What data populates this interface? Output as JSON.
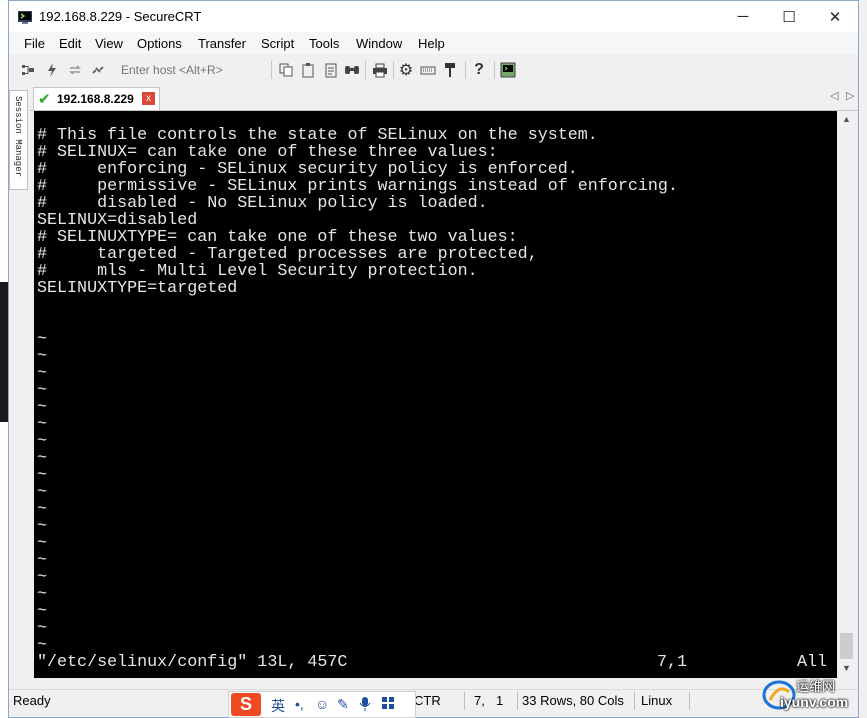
{
  "window": {
    "title": "192.168.8.229 - SecureCRT",
    "controls": {
      "minimize": "─",
      "maximize": "☐",
      "close": "✕"
    }
  },
  "menubar": {
    "items": [
      "File",
      "Edit",
      "View",
      "Options",
      "Transfer",
      "Script",
      "Tools",
      "Window",
      "Help"
    ]
  },
  "toolbar": {
    "host_placeholder": "Enter host <Alt+R>",
    "icons": [
      "connect-icon",
      "quick-connect-icon",
      "reconnect-icon",
      "disconnect-icon",
      "copy-icon",
      "paste-icon",
      "clipboard-icon",
      "find-icon",
      "print-icon",
      "settings-icon",
      "keymap-icon",
      "sftp-icon",
      "help-icon",
      "about-icon"
    ]
  },
  "sidebar": {
    "session_manager_label": "Session Manager"
  },
  "tabs": [
    {
      "label": "192.168.8.229",
      "status": "connected",
      "close": "x"
    }
  ],
  "tab_nav": {
    "prev": "◁",
    "next": "▷"
  },
  "terminal": {
    "lines": [
      "# This file controls the state of SELinux on the system.",
      "# SELINUX= can take one of these three values:",
      "#     enforcing - SELinux security policy is enforced.",
      "#     permissive - SELinux prints warnings instead of enforcing.",
      "#     disabled - No SELinux policy is loaded.",
      "SELINUX=disabled",
      "# SELINUXTYPE= can take one of these two values:",
      "#     targeted - Targeted processes are protected,",
      "#     mls - Multi Level Security protection.",
      "SELINUXTYPE=targeted",
      "",
      "",
      "~",
      "~",
      "~",
      "~",
      "~",
      "~",
      "~",
      "~",
      "~",
      "~",
      "~",
      "~",
      "~",
      "~",
      "~",
      "~",
      "~",
      "~",
      "~"
    ],
    "status_file": "\"/etc/selinux/config\" 13L, 457C",
    "status_position": "7,1",
    "status_percent": "All",
    "colors": {
      "background": "#000000",
      "foreground": "#e6e6e6"
    }
  },
  "statusbar": {
    "ready": "Ready",
    "protocol": "CTR",
    "row": "7,",
    "col": "1",
    "size": "33 Rows, 80 Cols",
    "terminal_type": "Linux"
  },
  "ime": {
    "logo": "S",
    "mode": "英"
  },
  "watermark": {
    "line1": "运维网",
    "line2": "iyunv.com"
  }
}
